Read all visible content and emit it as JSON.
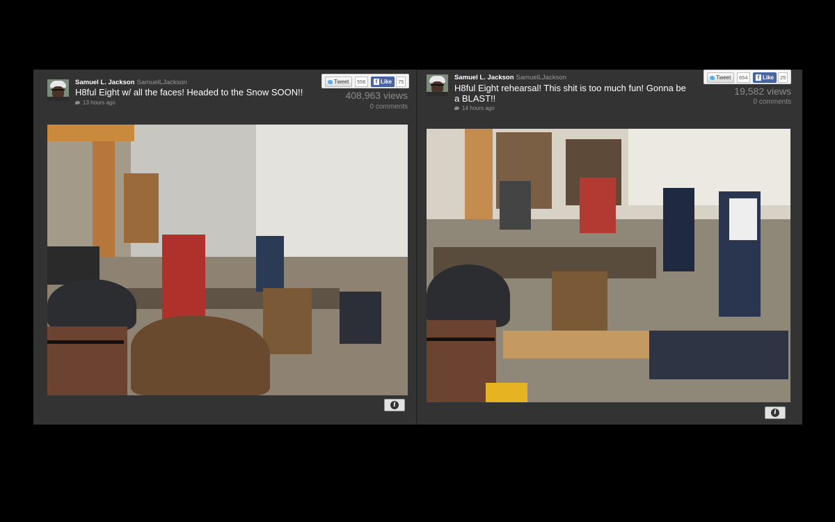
{
  "posts": [
    {
      "user_name": "Samuel L. Jackson",
      "user_handle": "SamuelLJackson",
      "text": "H8ful Eight w/ all the faces! Headed to the Snow SOON!!",
      "time": "13 hours ago",
      "tweet_label": "Tweet",
      "tweet_count": "556",
      "like_label": "Like",
      "like_count": "75",
      "views": "408,963 views",
      "comments": "0 comments",
      "info_icon": "i"
    },
    {
      "user_name": "Samuel L. Jackson",
      "user_handle": "SamuelLJackson",
      "text": "H8ful Eight rehearsal! This shit is too much fun! Gonna be a BLAST!!",
      "time": "14 hours ago",
      "tweet_label": "Tweet",
      "tweet_count": "654",
      "like_label": "Like",
      "like_count": "25",
      "views": "19,582 views",
      "comments": "0 comments",
      "info_icon": "i"
    }
  ],
  "icons": {
    "twitter": "twitter-bird-icon",
    "facebook": "facebook-f-icon",
    "info": "info-icon",
    "time": "twitter-small-icon"
  },
  "colors": {
    "background": "#000000",
    "panel": "#333333",
    "facebook": "#3b5998",
    "twitter": "#55acee"
  }
}
